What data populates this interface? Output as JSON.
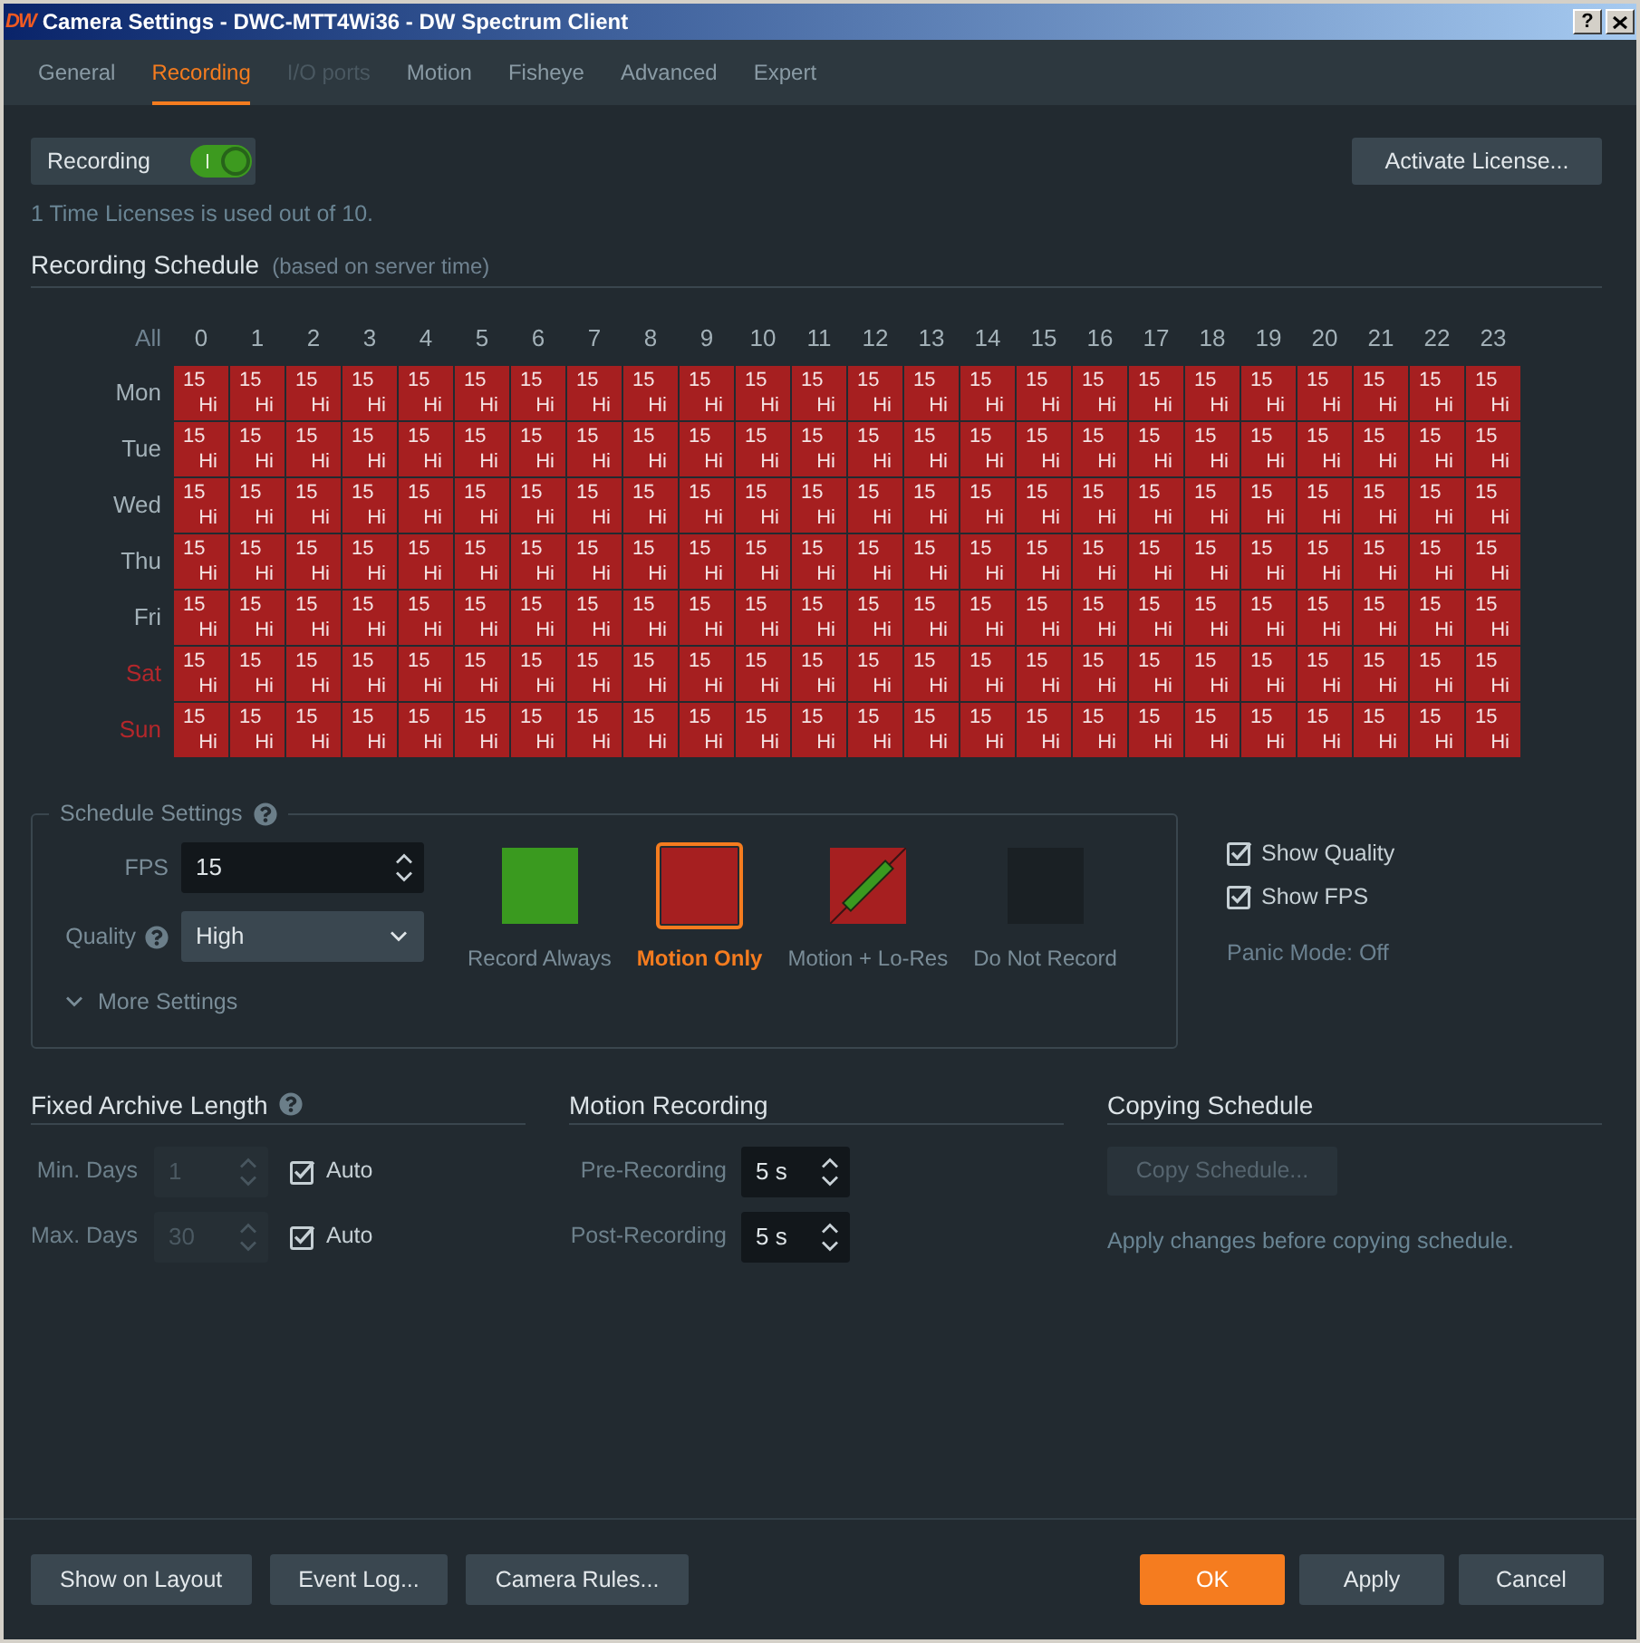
{
  "window": {
    "logo": "DW",
    "title": "Camera Settings - DWC-MTT4Wi36 - DW Spectrum Client",
    "help": "?"
  },
  "tabs": [
    {
      "label": "General",
      "selected": false,
      "disabled": false
    },
    {
      "label": "Recording",
      "selected": true,
      "disabled": false
    },
    {
      "label": "I/O ports",
      "selected": false,
      "disabled": true
    },
    {
      "label": "Motion",
      "selected": false,
      "disabled": false
    },
    {
      "label": "Fisheye",
      "selected": false,
      "disabled": false
    },
    {
      "label": "Advanced",
      "selected": false,
      "disabled": false
    },
    {
      "label": "Expert",
      "selected": false,
      "disabled": false
    }
  ],
  "recording": {
    "label": "Recording",
    "on": true
  },
  "activate_license": {
    "label": "Activate License..."
  },
  "license_info": "1 Time Licenses is used out of 10.",
  "schedule": {
    "title": "Recording Schedule",
    "subtitle": "(based on server time)",
    "all_label": "All",
    "hours": [
      "0",
      "1",
      "2",
      "3",
      "4",
      "5",
      "6",
      "7",
      "8",
      "9",
      "10",
      "11",
      "12",
      "13",
      "14",
      "15",
      "16",
      "17",
      "18",
      "19",
      "20",
      "21",
      "22",
      "23"
    ],
    "days": [
      {
        "label": "Mon",
        "weekend": false,
        "cells": [
          {
            "fps": "15",
            "quality": "Hi",
            "kind": "motion_only"
          },
          {
            "fps": "15",
            "quality": "Hi",
            "kind": "motion_only"
          },
          {
            "fps": "15",
            "quality": "Hi",
            "kind": "motion_only"
          },
          {
            "fps": "15",
            "quality": "Hi",
            "kind": "motion_only"
          },
          {
            "fps": "15",
            "quality": "Hi",
            "kind": "motion_only"
          },
          {
            "fps": "15",
            "quality": "Hi",
            "kind": "motion_only"
          },
          {
            "fps": "15",
            "quality": "Hi",
            "kind": "motion_only"
          },
          {
            "fps": "15",
            "quality": "Hi",
            "kind": "motion_only"
          },
          {
            "fps": "15",
            "quality": "Hi",
            "kind": "motion_only"
          },
          {
            "fps": "15",
            "quality": "Hi",
            "kind": "motion_only"
          },
          {
            "fps": "15",
            "quality": "Hi",
            "kind": "motion_only"
          },
          {
            "fps": "15",
            "quality": "Hi",
            "kind": "motion_only"
          },
          {
            "fps": "15",
            "quality": "Hi",
            "kind": "motion_only"
          },
          {
            "fps": "15",
            "quality": "Hi",
            "kind": "motion_only"
          },
          {
            "fps": "15",
            "quality": "Hi",
            "kind": "motion_only"
          },
          {
            "fps": "15",
            "quality": "Hi",
            "kind": "motion_only"
          },
          {
            "fps": "15",
            "quality": "Hi",
            "kind": "motion_only"
          },
          {
            "fps": "15",
            "quality": "Hi",
            "kind": "motion_only"
          },
          {
            "fps": "15",
            "quality": "Hi",
            "kind": "motion_only"
          },
          {
            "fps": "15",
            "quality": "Hi",
            "kind": "motion_only"
          },
          {
            "fps": "15",
            "quality": "Hi",
            "kind": "motion_only"
          },
          {
            "fps": "15",
            "quality": "Hi",
            "kind": "motion_only"
          },
          {
            "fps": "15",
            "quality": "Hi",
            "kind": "motion_only"
          },
          {
            "fps": "15",
            "quality": "Hi",
            "kind": "motion_only"
          }
        ]
      },
      {
        "label": "Tue",
        "weekend": false,
        "cells": [
          {
            "fps": "15",
            "quality": "Hi",
            "kind": "motion_only"
          },
          {
            "fps": "15",
            "quality": "Hi",
            "kind": "motion_only"
          },
          {
            "fps": "15",
            "quality": "Hi",
            "kind": "motion_only"
          },
          {
            "fps": "15",
            "quality": "Hi",
            "kind": "motion_only"
          },
          {
            "fps": "15",
            "quality": "Hi",
            "kind": "motion_only"
          },
          {
            "fps": "15",
            "quality": "Hi",
            "kind": "motion_only"
          },
          {
            "fps": "15",
            "quality": "Hi",
            "kind": "motion_only"
          },
          {
            "fps": "15",
            "quality": "Hi",
            "kind": "motion_only"
          },
          {
            "fps": "15",
            "quality": "Hi",
            "kind": "motion_only"
          },
          {
            "fps": "15",
            "quality": "Hi",
            "kind": "motion_only"
          },
          {
            "fps": "15",
            "quality": "Hi",
            "kind": "motion_only"
          },
          {
            "fps": "15",
            "quality": "Hi",
            "kind": "motion_only"
          },
          {
            "fps": "15",
            "quality": "Hi",
            "kind": "motion_only"
          },
          {
            "fps": "15",
            "quality": "Hi",
            "kind": "motion_only"
          },
          {
            "fps": "15",
            "quality": "Hi",
            "kind": "motion_only"
          },
          {
            "fps": "15",
            "quality": "Hi",
            "kind": "motion_only"
          },
          {
            "fps": "15",
            "quality": "Hi",
            "kind": "motion_only"
          },
          {
            "fps": "15",
            "quality": "Hi",
            "kind": "motion_only"
          },
          {
            "fps": "15",
            "quality": "Hi",
            "kind": "motion_only"
          },
          {
            "fps": "15",
            "quality": "Hi",
            "kind": "motion_only"
          },
          {
            "fps": "15",
            "quality": "Hi",
            "kind": "motion_only"
          },
          {
            "fps": "15",
            "quality": "Hi",
            "kind": "motion_only"
          },
          {
            "fps": "15",
            "quality": "Hi",
            "kind": "motion_only"
          },
          {
            "fps": "15",
            "quality": "Hi",
            "kind": "motion_only"
          }
        ]
      },
      {
        "label": "Wed",
        "weekend": false,
        "cells": [
          {
            "fps": "15",
            "quality": "Hi",
            "kind": "motion_only"
          },
          {
            "fps": "15",
            "quality": "Hi",
            "kind": "motion_only"
          },
          {
            "fps": "15",
            "quality": "Hi",
            "kind": "motion_only"
          },
          {
            "fps": "15",
            "quality": "Hi",
            "kind": "motion_only"
          },
          {
            "fps": "15",
            "quality": "Hi",
            "kind": "motion_only"
          },
          {
            "fps": "15",
            "quality": "Hi",
            "kind": "motion_only"
          },
          {
            "fps": "15",
            "quality": "Hi",
            "kind": "motion_only"
          },
          {
            "fps": "15",
            "quality": "Hi",
            "kind": "motion_only"
          },
          {
            "fps": "15",
            "quality": "Hi",
            "kind": "motion_only"
          },
          {
            "fps": "15",
            "quality": "Hi",
            "kind": "motion_only"
          },
          {
            "fps": "15",
            "quality": "Hi",
            "kind": "motion_only"
          },
          {
            "fps": "15",
            "quality": "Hi",
            "kind": "motion_only"
          },
          {
            "fps": "15",
            "quality": "Hi",
            "kind": "motion_only"
          },
          {
            "fps": "15",
            "quality": "Hi",
            "kind": "motion_only"
          },
          {
            "fps": "15",
            "quality": "Hi",
            "kind": "motion_only"
          },
          {
            "fps": "15",
            "quality": "Hi",
            "kind": "motion_only"
          },
          {
            "fps": "15",
            "quality": "Hi",
            "kind": "motion_only"
          },
          {
            "fps": "15",
            "quality": "Hi",
            "kind": "motion_only"
          },
          {
            "fps": "15",
            "quality": "Hi",
            "kind": "motion_only"
          },
          {
            "fps": "15",
            "quality": "Hi",
            "kind": "motion_only"
          },
          {
            "fps": "15",
            "quality": "Hi",
            "kind": "motion_only"
          },
          {
            "fps": "15",
            "quality": "Hi",
            "kind": "motion_only"
          },
          {
            "fps": "15",
            "quality": "Hi",
            "kind": "motion_only"
          },
          {
            "fps": "15",
            "quality": "Hi",
            "kind": "motion_only"
          }
        ]
      },
      {
        "label": "Thu",
        "weekend": false,
        "cells": [
          {
            "fps": "15",
            "quality": "Hi",
            "kind": "motion_only"
          },
          {
            "fps": "15",
            "quality": "Hi",
            "kind": "motion_only"
          },
          {
            "fps": "15",
            "quality": "Hi",
            "kind": "motion_only"
          },
          {
            "fps": "15",
            "quality": "Hi",
            "kind": "motion_only"
          },
          {
            "fps": "15",
            "quality": "Hi",
            "kind": "motion_only"
          },
          {
            "fps": "15",
            "quality": "Hi",
            "kind": "motion_only"
          },
          {
            "fps": "15",
            "quality": "Hi",
            "kind": "motion_only"
          },
          {
            "fps": "15",
            "quality": "Hi",
            "kind": "motion_only"
          },
          {
            "fps": "15",
            "quality": "Hi",
            "kind": "motion_only"
          },
          {
            "fps": "15",
            "quality": "Hi",
            "kind": "motion_only"
          },
          {
            "fps": "15",
            "quality": "Hi",
            "kind": "motion_only"
          },
          {
            "fps": "15",
            "quality": "Hi",
            "kind": "motion_only"
          },
          {
            "fps": "15",
            "quality": "Hi",
            "kind": "motion_only"
          },
          {
            "fps": "15",
            "quality": "Hi",
            "kind": "motion_only"
          },
          {
            "fps": "15",
            "quality": "Hi",
            "kind": "motion_only"
          },
          {
            "fps": "15",
            "quality": "Hi",
            "kind": "motion_only"
          },
          {
            "fps": "15",
            "quality": "Hi",
            "kind": "motion_only"
          },
          {
            "fps": "15",
            "quality": "Hi",
            "kind": "motion_only"
          },
          {
            "fps": "15",
            "quality": "Hi",
            "kind": "motion_only"
          },
          {
            "fps": "15",
            "quality": "Hi",
            "kind": "motion_only"
          },
          {
            "fps": "15",
            "quality": "Hi",
            "kind": "motion_only"
          },
          {
            "fps": "15",
            "quality": "Hi",
            "kind": "motion_only"
          },
          {
            "fps": "15",
            "quality": "Hi",
            "kind": "motion_only"
          },
          {
            "fps": "15",
            "quality": "Hi",
            "kind": "motion_only"
          }
        ]
      },
      {
        "label": "Fri",
        "weekend": false,
        "cells": [
          {
            "fps": "15",
            "quality": "Hi",
            "kind": "motion_only"
          },
          {
            "fps": "15",
            "quality": "Hi",
            "kind": "motion_only"
          },
          {
            "fps": "15",
            "quality": "Hi",
            "kind": "motion_only"
          },
          {
            "fps": "15",
            "quality": "Hi",
            "kind": "motion_only"
          },
          {
            "fps": "15",
            "quality": "Hi",
            "kind": "motion_only"
          },
          {
            "fps": "15",
            "quality": "Hi",
            "kind": "motion_only"
          },
          {
            "fps": "15",
            "quality": "Hi",
            "kind": "motion_only"
          },
          {
            "fps": "15",
            "quality": "Hi",
            "kind": "motion_only"
          },
          {
            "fps": "15",
            "quality": "Hi",
            "kind": "motion_only"
          },
          {
            "fps": "15",
            "quality": "Hi",
            "kind": "motion_only"
          },
          {
            "fps": "15",
            "quality": "Hi",
            "kind": "motion_only"
          },
          {
            "fps": "15",
            "quality": "Hi",
            "kind": "motion_only"
          },
          {
            "fps": "15",
            "quality": "Hi",
            "kind": "motion_only"
          },
          {
            "fps": "15",
            "quality": "Hi",
            "kind": "motion_only"
          },
          {
            "fps": "15",
            "quality": "Hi",
            "kind": "motion_only"
          },
          {
            "fps": "15",
            "quality": "Hi",
            "kind": "motion_only"
          },
          {
            "fps": "15",
            "quality": "Hi",
            "kind": "motion_only"
          },
          {
            "fps": "15",
            "quality": "Hi",
            "kind": "motion_only"
          },
          {
            "fps": "15",
            "quality": "Hi",
            "kind": "motion_only"
          },
          {
            "fps": "15",
            "quality": "Hi",
            "kind": "motion_only"
          },
          {
            "fps": "15",
            "quality": "Hi",
            "kind": "motion_only"
          },
          {
            "fps": "15",
            "quality": "Hi",
            "kind": "motion_only"
          },
          {
            "fps": "15",
            "quality": "Hi",
            "kind": "motion_only"
          },
          {
            "fps": "15",
            "quality": "Hi",
            "kind": "motion_only"
          }
        ]
      },
      {
        "label": "Sat",
        "weekend": true,
        "cells": [
          {
            "fps": "15",
            "quality": "Hi",
            "kind": "motion_only"
          },
          {
            "fps": "15",
            "quality": "Hi",
            "kind": "motion_only"
          },
          {
            "fps": "15",
            "quality": "Hi",
            "kind": "motion_only"
          },
          {
            "fps": "15",
            "quality": "Hi",
            "kind": "motion_only"
          },
          {
            "fps": "15",
            "quality": "Hi",
            "kind": "motion_only"
          },
          {
            "fps": "15",
            "quality": "Hi",
            "kind": "motion_only"
          },
          {
            "fps": "15",
            "quality": "Hi",
            "kind": "motion_only"
          },
          {
            "fps": "15",
            "quality": "Hi",
            "kind": "motion_only"
          },
          {
            "fps": "15",
            "quality": "Hi",
            "kind": "motion_only"
          },
          {
            "fps": "15",
            "quality": "Hi",
            "kind": "motion_only"
          },
          {
            "fps": "15",
            "quality": "Hi",
            "kind": "motion_only"
          },
          {
            "fps": "15",
            "quality": "Hi",
            "kind": "motion_only"
          },
          {
            "fps": "15",
            "quality": "Hi",
            "kind": "motion_only"
          },
          {
            "fps": "15",
            "quality": "Hi",
            "kind": "motion_only"
          },
          {
            "fps": "15",
            "quality": "Hi",
            "kind": "motion_only"
          },
          {
            "fps": "15",
            "quality": "Hi",
            "kind": "motion_only"
          },
          {
            "fps": "15",
            "quality": "Hi",
            "kind": "motion_only"
          },
          {
            "fps": "15",
            "quality": "Hi",
            "kind": "motion_only"
          },
          {
            "fps": "15",
            "quality": "Hi",
            "kind": "motion_only"
          },
          {
            "fps": "15",
            "quality": "Hi",
            "kind": "motion_only"
          },
          {
            "fps": "15",
            "quality": "Hi",
            "kind": "motion_only"
          },
          {
            "fps": "15",
            "quality": "Hi",
            "kind": "motion_only"
          },
          {
            "fps": "15",
            "quality": "Hi",
            "kind": "motion_only"
          },
          {
            "fps": "15",
            "quality": "Hi",
            "kind": "motion_only"
          }
        ]
      },
      {
        "label": "Sun",
        "weekend": true,
        "cells": [
          {
            "fps": "15",
            "quality": "Hi",
            "kind": "motion_only"
          },
          {
            "fps": "15",
            "quality": "Hi",
            "kind": "motion_only"
          },
          {
            "fps": "15",
            "quality": "Hi",
            "kind": "motion_only"
          },
          {
            "fps": "15",
            "quality": "Hi",
            "kind": "motion_only"
          },
          {
            "fps": "15",
            "quality": "Hi",
            "kind": "motion_only"
          },
          {
            "fps": "15",
            "quality": "Hi",
            "kind": "motion_only"
          },
          {
            "fps": "15",
            "quality": "Hi",
            "kind": "motion_only"
          },
          {
            "fps": "15",
            "quality": "Hi",
            "kind": "motion_only"
          },
          {
            "fps": "15",
            "quality": "Hi",
            "kind": "motion_only"
          },
          {
            "fps": "15",
            "quality": "Hi",
            "kind": "motion_only"
          },
          {
            "fps": "15",
            "quality": "Hi",
            "kind": "motion_only"
          },
          {
            "fps": "15",
            "quality": "Hi",
            "kind": "motion_only"
          },
          {
            "fps": "15",
            "quality": "Hi",
            "kind": "motion_only"
          },
          {
            "fps": "15",
            "quality": "Hi",
            "kind": "motion_only"
          },
          {
            "fps": "15",
            "quality": "Hi",
            "kind": "motion_only"
          },
          {
            "fps": "15",
            "quality": "Hi",
            "kind": "motion_only"
          },
          {
            "fps": "15",
            "quality": "Hi",
            "kind": "motion_only"
          },
          {
            "fps": "15",
            "quality": "Hi",
            "kind": "motion_only"
          },
          {
            "fps": "15",
            "quality": "Hi",
            "kind": "motion_only"
          },
          {
            "fps": "15",
            "quality": "Hi",
            "kind": "motion_only"
          },
          {
            "fps": "15",
            "quality": "Hi",
            "kind": "motion_only"
          },
          {
            "fps": "15",
            "quality": "Hi",
            "kind": "motion_only"
          },
          {
            "fps": "15",
            "quality": "Hi",
            "kind": "motion_only"
          },
          {
            "fps": "15",
            "quality": "Hi",
            "kind": "motion_only"
          }
        ]
      }
    ]
  },
  "schedule_settings": {
    "title": "Schedule Settings",
    "fps": {
      "label": "FPS",
      "value": "15"
    },
    "quality": {
      "label": "Quality",
      "value": "High"
    },
    "more_settings": {
      "label": "More Settings",
      "expanded": false
    },
    "modes": [
      {
        "label": "Record Always",
        "kind": "always",
        "selected": false
      },
      {
        "label": "Motion Only",
        "kind": "motion_only",
        "selected": true
      },
      {
        "label": "Motion + Lo-Res",
        "kind": "motion_lowres",
        "selected": false
      },
      {
        "label": "Do Not Record",
        "kind": "none",
        "selected": false
      }
    ]
  },
  "display_options": [
    {
      "label": "Show Quality",
      "checked": true
    },
    {
      "label": "Show FPS",
      "checked": true
    }
  ],
  "panic_mode": "Panic Mode: Off",
  "archive": {
    "title": "Fixed Archive Length",
    "rows": [
      {
        "label": "Min. Days",
        "value": "1",
        "disabled": true,
        "auto": {
          "label": "Auto",
          "checked": true
        }
      },
      {
        "label": "Max. Days",
        "value": "30",
        "disabled": true,
        "auto": {
          "label": "Auto",
          "checked": true
        }
      }
    ]
  },
  "motion_recording": {
    "title": "Motion Recording",
    "rows": [
      {
        "label": "Pre-Recording",
        "value": "5 s"
      },
      {
        "label": "Post-Recording",
        "value": "5 s"
      }
    ]
  },
  "copying_schedule": {
    "title": "Copying Schedule",
    "button": {
      "label": "Copy Schedule...",
      "disabled": true
    },
    "note": "Apply changes before copying schedule."
  },
  "footer": {
    "left_buttons": [
      {
        "label": "Show on Layout"
      },
      {
        "label": "Event Log..."
      },
      {
        "label": "Camera Rules..."
      }
    ],
    "right_buttons": [
      {
        "label": "OK",
        "kind": "primary"
      },
      {
        "label": "Apply",
        "kind": "default"
      },
      {
        "label": "Cancel",
        "kind": "default"
      }
    ]
  }
}
